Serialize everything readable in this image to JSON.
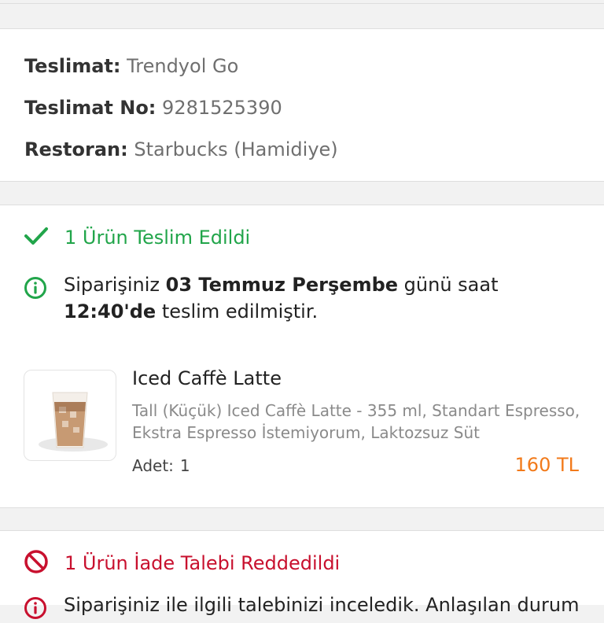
{
  "delivery": {
    "company_label": "Teslimat:",
    "company_value": "Trendyol Go",
    "number_label": "Teslimat No:",
    "number_value": "9281525390",
    "restaurant_label": "Restoran:",
    "restaurant_value": "Starbucks (Hamidiye)"
  },
  "delivered": {
    "status_text": "1 Ürün Teslim Edildi",
    "status_color": "#21a54a",
    "info_prefix": "Siparişiniz ",
    "info_date": "03 Temmuz Perşembe",
    "info_middle": " günü saat ",
    "info_time": "12:40'de",
    "info_suffix": " teslim edilmiştir."
  },
  "product": {
    "title": "Iced Caffè Latte",
    "description": "Tall (Küçük) Iced Caffè Latte - 355 ml, Standart Espresso, Ekstra Espresso İstemiyorum, Laktozsuz Süt",
    "qty_label": "Adet:",
    "qty_value": "1",
    "price": "160 TL",
    "price_color": "#f27a1a"
  },
  "refund": {
    "status_text": "1 Ürün İade Talebi Reddedildi",
    "status_color": "#c8102e",
    "info_partial": "Siparişiniz ile ilgili talebinizi inceledik. Anlaşılan durum"
  }
}
